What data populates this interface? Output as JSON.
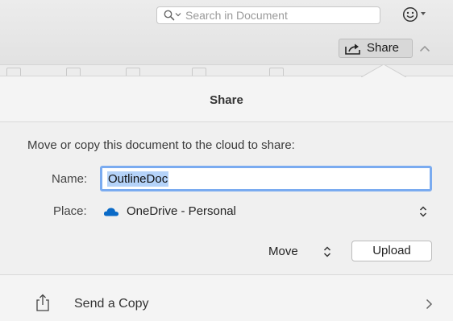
{
  "toolbar": {
    "search_placeholder": "Search in Document",
    "share_label": "Share"
  },
  "popover": {
    "title": "Share",
    "instruction": "Move or copy this document to the cloud to share:",
    "name_label": "Name:",
    "name_value": "OutlineDoc",
    "place_label": "Place:",
    "place_value": "OneDrive - Personal",
    "move_label": "Move",
    "upload_label": "Upload",
    "send_copy_label": "Send a Copy"
  },
  "colors": {
    "accent_focus": "#7aabf0",
    "selection": "#b5d3f9",
    "onedrive": "#0a6ac7"
  }
}
